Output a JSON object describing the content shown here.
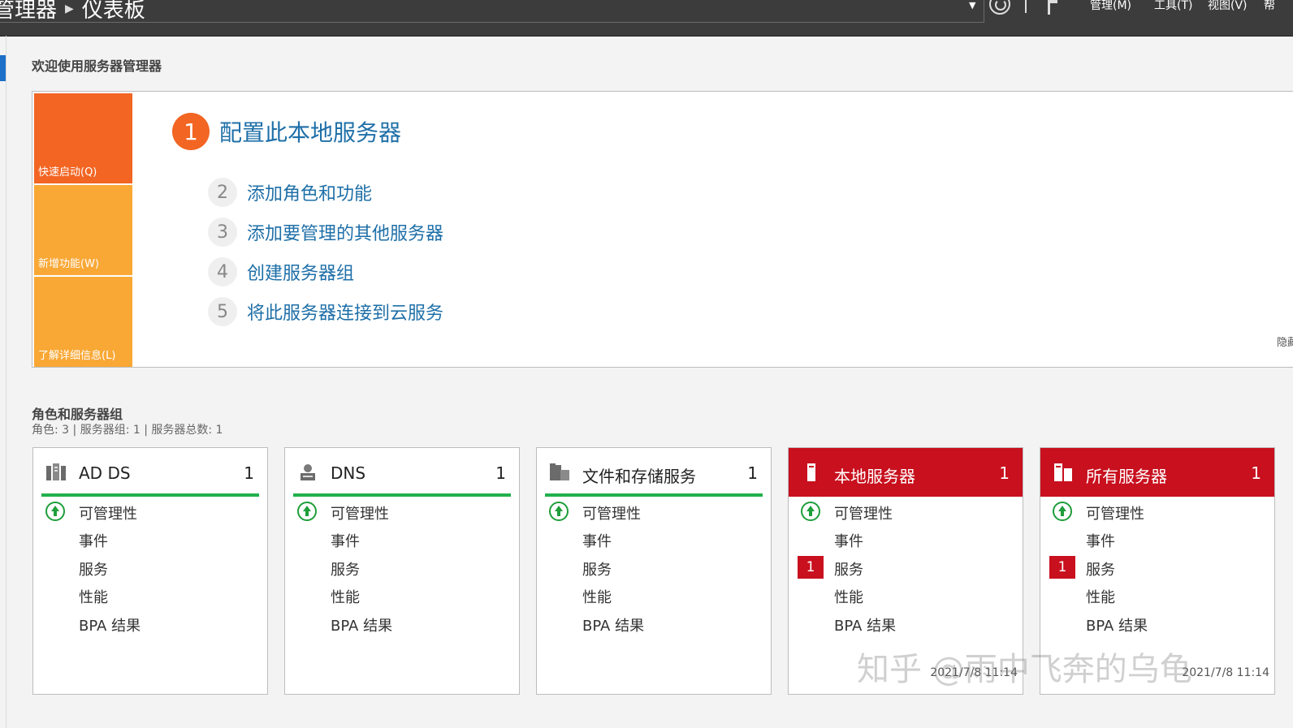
{
  "header": {
    "breadcrumb": [
      "管理器",
      "仪表板"
    ],
    "menus": [
      "管理(M)",
      "工具(T)",
      "视图(V)",
      "帮"
    ]
  },
  "welcome": {
    "title": "欢迎使用服务器管理器",
    "tiles": [
      "快速启动(Q)",
      "新增功能(W)",
      "了解详细信息(L)"
    ],
    "main_step": {
      "num": "1",
      "label": "配置此本地服务器"
    },
    "steps": [
      {
        "num": "2",
        "label": "添加角色和功能"
      },
      {
        "num": "3",
        "label": "添加要管理的其他服务器"
      },
      {
        "num": "4",
        "label": "创建服务器组"
      },
      {
        "num": "5",
        "label": "将此服务器连接到云服务"
      }
    ],
    "hide_label": "隐藏"
  },
  "roles": {
    "title": "角色和服务器组",
    "subtitle": "角色: 3 | 服务器组: 1 | 服务器总数: 1",
    "cards": [
      {
        "title": "AD DS",
        "count": "1",
        "icon": "ad-ds-icon",
        "rows": [
          "可管理性",
          "事件",
          "服务",
          "性能",
          "BPA 结果"
        ],
        "badge": "",
        "timestamp": ""
      },
      {
        "title": "DNS",
        "count": "1",
        "icon": "dns-icon",
        "rows": [
          "可管理性",
          "事件",
          "服务",
          "性能",
          "BPA 结果"
        ],
        "badge": "",
        "timestamp": ""
      },
      {
        "title": "文件和存储服务",
        "count": "1",
        "icon": "file-storage-icon",
        "rows": [
          "可管理性",
          "事件",
          "服务",
          "性能",
          "BPA 结果"
        ],
        "badge": "",
        "timestamp": ""
      },
      {
        "title": "本地服务器",
        "count": "1",
        "icon": "local-server-icon",
        "rows": [
          "可管理性",
          "事件",
          "服务",
          "性能",
          "BPA 结果"
        ],
        "badge": "1",
        "timestamp": "2021/7/8 11:14"
      },
      {
        "title": "所有服务器",
        "count": "1",
        "icon": "all-servers-icon",
        "rows": [
          "可管理性",
          "事件",
          "服务",
          "性能",
          "BPA 结果"
        ],
        "badge": "1",
        "timestamp": "2021/7/8 11:14"
      }
    ]
  },
  "watermark": "知乎 @雨中飞奔的乌龟",
  "colors": {
    "accent_orange": "#f26522",
    "tile_orange": "#f9a836",
    "link_blue": "#1e6fa8",
    "status_green": "#22b14c",
    "alert_red": "#c8101e"
  }
}
